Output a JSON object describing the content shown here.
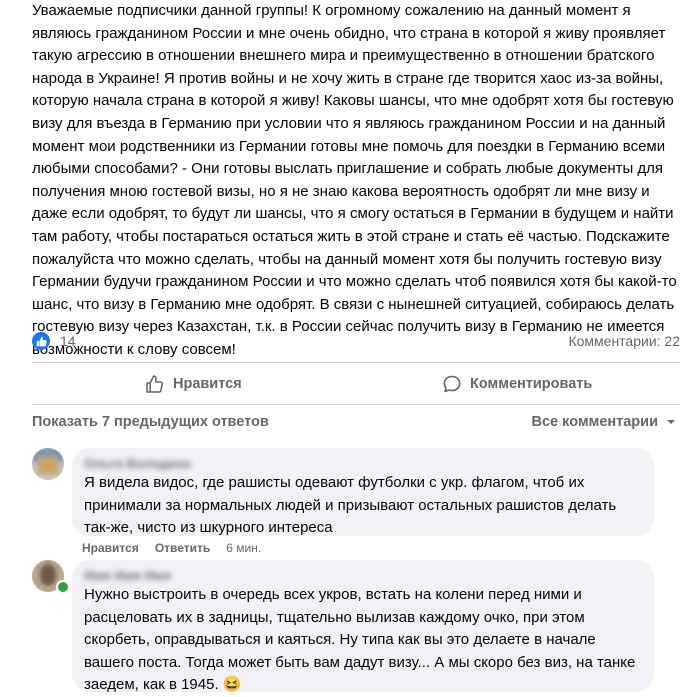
{
  "post": {
    "text": "Уважаемые подписчики данной группы! К огромному сожалению на данный момент я являюсь гражданином России и мне очень обидно, что страна в которой я живу проявляет такую агрессию в отношении внешнего мира и преимущественно в отношении братского народа в Украине! Я против войны и не хочу жить в стране где творится хаос из-за войны, которую начала страна в которой я живу! Каковы шансы, что мне одобрят хотя бы гостевую визу для въезда в Германию при условии что я являюсь гражданином России и на данный момент мои родственники из Германии готовы мне помочь для поездки в Германию всеми любыми способами? - Они готовы выслать приглашение и собрать любые документы для получения мною гостевой визы, но я не знаю какова вероятность одобрят ли мне визу и даже если одобрят, то будут ли шансы, что я смогу остаться в Германии в будущем и найти там работу, чтобы постараться остаться жить в этой стране и стать её частью. Подскажите пожалуйста что можно сделать, чтобы на данный момент хотя бы получить гостевую визу Германии будучи гражданином России и что можно сделать чтоб появился хотя бы какой-то шанс, что визу в Германию мне одобрят. В связи с нынешней ситуацией, собираюсь делать гостевую визу через Казахстан, т.к. в России сейчас получить визу в Германию не имеется возможности к слову совсем!",
    "reaction_count": "14",
    "comments_count": "Комментарии: 22"
  },
  "actions": {
    "like_label": "Нравится",
    "comment_label": "Комментировать"
  },
  "comments_header": {
    "show_previous": "Показать 7 предыдущих ответов",
    "all_comments": "Все комментарии"
  },
  "comments": [
    {
      "author": "Ольга Володина",
      "text": "Я видела видос, где рашисты одевают футболки с укр. флагом, чтоб их принимали за нормальных людей и призывают остальных рашистов делать так-же, чисто из шкурного интереса",
      "like_label": "Нравится",
      "reply_label": "Ответить",
      "time": "6 мин."
    },
    {
      "author": "Имя Имя Имя",
      "text": "Нужно выстроить в очередь всех укров, встать на колени перед ними и расцеловать их в задницы, тщательно вылизав каждому очко, при этом скорбеть, оправдываться и каяться. Ну типа как вы это делаете в начале вашего поста. Тогда может быть вам дадут визу... А мы скоро без виз, на танке заедем, как в 1945.",
      "emoji": "😆"
    }
  ],
  "colors": {
    "accent": "#1877f2",
    "muted_text": "#65676b",
    "bubble_bg": "#f0f2f5",
    "divider": "#ced0d4"
  }
}
